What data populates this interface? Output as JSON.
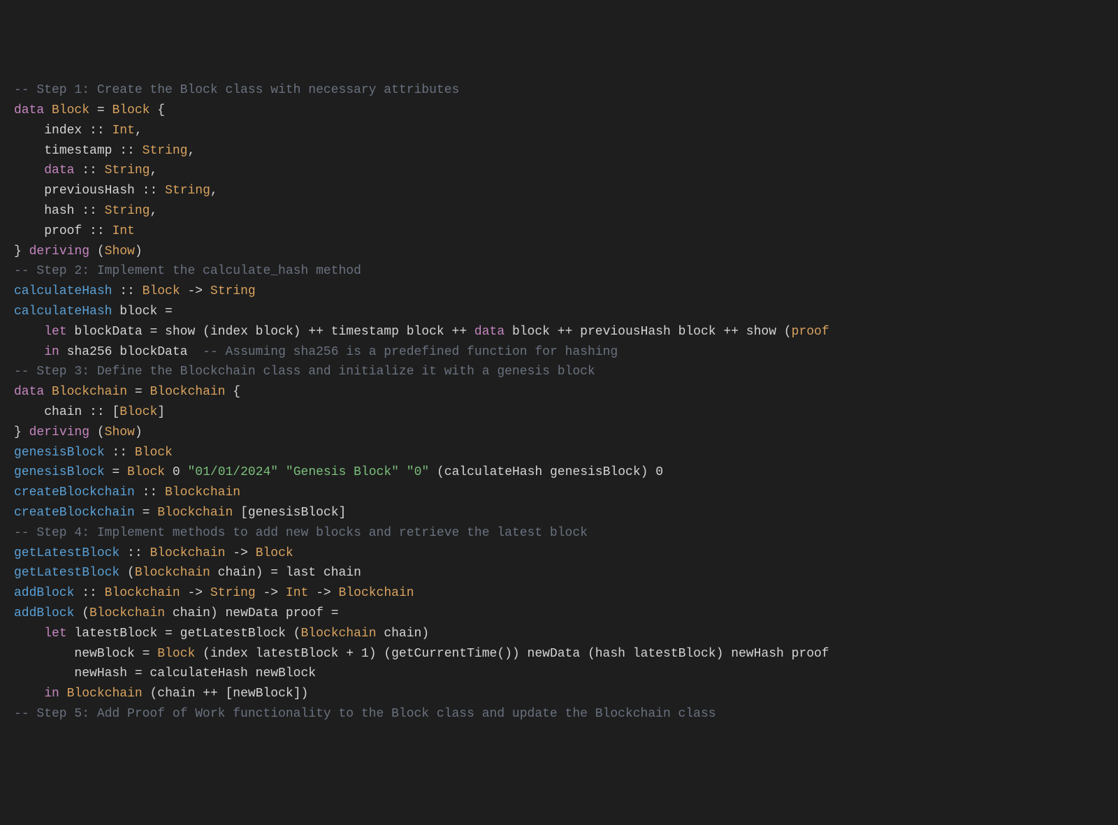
{
  "lines": [
    {
      "segments": [
        {
          "cls": "comment",
          "t": "-- Step 1: Create the Block class with necessary attributes"
        }
      ]
    },
    {
      "segments": [
        {
          "cls": "keyword",
          "t": "data"
        },
        {
          "cls": "op",
          "t": " "
        },
        {
          "cls": "type",
          "t": "Block"
        },
        {
          "cls": "op",
          "t": " = "
        },
        {
          "cls": "type",
          "t": "Block"
        },
        {
          "cls": "op",
          "t": " {"
        }
      ]
    },
    {
      "segments": [
        {
          "cls": "op",
          "t": "    "
        },
        {
          "cls": "field",
          "t": "index"
        },
        {
          "cls": "op",
          "t": " :: "
        },
        {
          "cls": "type",
          "t": "Int"
        },
        {
          "cls": "op",
          "t": ","
        }
      ]
    },
    {
      "segments": [
        {
          "cls": "op",
          "t": "    "
        },
        {
          "cls": "field",
          "t": "timestamp"
        },
        {
          "cls": "op",
          "t": " :: "
        },
        {
          "cls": "type",
          "t": "String"
        },
        {
          "cls": "op",
          "t": ","
        }
      ]
    },
    {
      "segments": [
        {
          "cls": "op",
          "t": "    "
        },
        {
          "cls": "keyword",
          "t": "data"
        },
        {
          "cls": "op",
          "t": " :: "
        },
        {
          "cls": "type",
          "t": "String"
        },
        {
          "cls": "op",
          "t": ","
        }
      ]
    },
    {
      "segments": [
        {
          "cls": "op",
          "t": "    "
        },
        {
          "cls": "field",
          "t": "previousHash"
        },
        {
          "cls": "op",
          "t": " :: "
        },
        {
          "cls": "type",
          "t": "String"
        },
        {
          "cls": "op",
          "t": ","
        }
      ]
    },
    {
      "segments": [
        {
          "cls": "op",
          "t": "    "
        },
        {
          "cls": "field",
          "t": "hash"
        },
        {
          "cls": "op",
          "t": " :: "
        },
        {
          "cls": "type",
          "t": "String"
        },
        {
          "cls": "op",
          "t": ","
        }
      ]
    },
    {
      "segments": [
        {
          "cls": "op",
          "t": "    "
        },
        {
          "cls": "field",
          "t": "proof"
        },
        {
          "cls": "op",
          "t": " :: "
        },
        {
          "cls": "type",
          "t": "Int"
        }
      ]
    },
    {
      "segments": [
        {
          "cls": "op",
          "t": "} "
        },
        {
          "cls": "deriving",
          "t": "deriving"
        },
        {
          "cls": "op",
          "t": " ("
        },
        {
          "cls": "show",
          "t": "Show"
        },
        {
          "cls": "op",
          "t": ")"
        }
      ]
    },
    {
      "segments": [
        {
          "cls": "op",
          "t": ""
        }
      ]
    },
    {
      "segments": [
        {
          "cls": "comment",
          "t": "-- Step 2: Implement the calculate_hash method"
        }
      ]
    },
    {
      "segments": [
        {
          "cls": "fn",
          "t": "calculateHash"
        },
        {
          "cls": "op",
          "t": " :: "
        },
        {
          "cls": "type",
          "t": "Block"
        },
        {
          "cls": "op",
          "t": " -> "
        },
        {
          "cls": "type",
          "t": "String"
        }
      ]
    },
    {
      "segments": [
        {
          "cls": "fn",
          "t": "calculateHash"
        },
        {
          "cls": "op",
          "t": " block ="
        }
      ]
    },
    {
      "segments": [
        {
          "cls": "op",
          "t": "    "
        },
        {
          "cls": "keyword",
          "t": "let"
        },
        {
          "cls": "op",
          "t": " blockData = show (index block) ++ timestamp block ++ "
        },
        {
          "cls": "keyword",
          "t": "data"
        },
        {
          "cls": "op",
          "t": " block ++ previousHash block ++ show ("
        },
        {
          "cls": "type",
          "t": "proof"
        }
      ]
    },
    {
      "segments": [
        {
          "cls": "op",
          "t": "    "
        },
        {
          "cls": "keyword",
          "t": "in"
        },
        {
          "cls": "op",
          "t": " sha256 blockData  "
        },
        {
          "cls": "comment",
          "t": "-- Assuming sha256 is a predefined function for hashing"
        }
      ]
    },
    {
      "segments": [
        {
          "cls": "op",
          "t": ""
        }
      ]
    },
    {
      "segments": [
        {
          "cls": "comment",
          "t": "-- Step 3: Define the Blockchain class and initialize it with a genesis block"
        }
      ]
    },
    {
      "segments": [
        {
          "cls": "keyword",
          "t": "data"
        },
        {
          "cls": "op",
          "t": " "
        },
        {
          "cls": "type",
          "t": "Blockchain"
        },
        {
          "cls": "op",
          "t": " = "
        },
        {
          "cls": "type",
          "t": "Blockchain"
        },
        {
          "cls": "op",
          "t": " {"
        }
      ]
    },
    {
      "segments": [
        {
          "cls": "op",
          "t": "    "
        },
        {
          "cls": "field",
          "t": "chain"
        },
        {
          "cls": "op",
          "t": " :: ["
        },
        {
          "cls": "type",
          "t": "Block"
        },
        {
          "cls": "op",
          "t": "]"
        }
      ]
    },
    {
      "segments": [
        {
          "cls": "op",
          "t": "} "
        },
        {
          "cls": "deriving",
          "t": "deriving"
        },
        {
          "cls": "op",
          "t": " ("
        },
        {
          "cls": "show",
          "t": "Show"
        },
        {
          "cls": "op",
          "t": ")"
        }
      ]
    },
    {
      "segments": [
        {
          "cls": "op",
          "t": ""
        }
      ]
    },
    {
      "segments": [
        {
          "cls": "fn",
          "t": "genesisBlock"
        },
        {
          "cls": "op",
          "t": " :: "
        },
        {
          "cls": "type",
          "t": "Block"
        }
      ]
    },
    {
      "segments": [
        {
          "cls": "fn",
          "t": "genesisBlock"
        },
        {
          "cls": "op",
          "t": " = "
        },
        {
          "cls": "type",
          "t": "Block"
        },
        {
          "cls": "op",
          "t": " "
        },
        {
          "cls": "num",
          "t": "0"
        },
        {
          "cls": "op",
          "t": " "
        },
        {
          "cls": "str",
          "t": "\"01/01/2024\""
        },
        {
          "cls": "op",
          "t": " "
        },
        {
          "cls": "str",
          "t": "\"Genesis Block\""
        },
        {
          "cls": "op",
          "t": " "
        },
        {
          "cls": "str",
          "t": "\"0\""
        },
        {
          "cls": "op",
          "t": " (calculateHash genesisBlock) "
        },
        {
          "cls": "num",
          "t": "0"
        }
      ]
    },
    {
      "segments": [
        {
          "cls": "op",
          "t": ""
        }
      ]
    },
    {
      "segments": [
        {
          "cls": "fn",
          "t": "createBlockchain"
        },
        {
          "cls": "op",
          "t": " :: "
        },
        {
          "cls": "type",
          "t": "Blockchain"
        }
      ]
    },
    {
      "segments": [
        {
          "cls": "fn",
          "t": "createBlockchain"
        },
        {
          "cls": "op",
          "t": " = "
        },
        {
          "cls": "type",
          "t": "Blockchain"
        },
        {
          "cls": "op",
          "t": " [genesisBlock]"
        }
      ]
    },
    {
      "segments": [
        {
          "cls": "op",
          "t": ""
        }
      ]
    },
    {
      "segments": [
        {
          "cls": "comment",
          "t": "-- Step 4: Implement methods to add new blocks and retrieve the latest block"
        }
      ]
    },
    {
      "segments": [
        {
          "cls": "fn",
          "t": "getLatestBlock"
        },
        {
          "cls": "op",
          "t": " :: "
        },
        {
          "cls": "type",
          "t": "Blockchain"
        },
        {
          "cls": "op",
          "t": " -> "
        },
        {
          "cls": "type",
          "t": "Block"
        }
      ]
    },
    {
      "segments": [
        {
          "cls": "fn",
          "t": "getLatestBlock"
        },
        {
          "cls": "op",
          "t": " ("
        },
        {
          "cls": "type",
          "t": "Blockchain"
        },
        {
          "cls": "op",
          "t": " chain) = last chain"
        }
      ]
    },
    {
      "segments": [
        {
          "cls": "op",
          "t": ""
        }
      ]
    },
    {
      "segments": [
        {
          "cls": "fn",
          "t": "addBlock"
        },
        {
          "cls": "op",
          "t": " :: "
        },
        {
          "cls": "type",
          "t": "Blockchain"
        },
        {
          "cls": "op",
          "t": " -> "
        },
        {
          "cls": "type",
          "t": "String"
        },
        {
          "cls": "op",
          "t": " -> "
        },
        {
          "cls": "type",
          "t": "Int"
        },
        {
          "cls": "op",
          "t": " -> "
        },
        {
          "cls": "type",
          "t": "Blockchain"
        }
      ]
    },
    {
      "segments": [
        {
          "cls": "fn",
          "t": "addBlock"
        },
        {
          "cls": "op",
          "t": " ("
        },
        {
          "cls": "type",
          "t": "Blockchain"
        },
        {
          "cls": "op",
          "t": " chain) newData proof ="
        }
      ]
    },
    {
      "segments": [
        {
          "cls": "op",
          "t": "    "
        },
        {
          "cls": "keyword",
          "t": "let"
        },
        {
          "cls": "op",
          "t": " latestBlock = getLatestBlock ("
        },
        {
          "cls": "type",
          "t": "Blockchain"
        },
        {
          "cls": "op",
          "t": " chain)"
        }
      ]
    },
    {
      "segments": [
        {
          "cls": "op",
          "t": "        newBlock = "
        },
        {
          "cls": "type",
          "t": "Block"
        },
        {
          "cls": "op",
          "t": " (index latestBlock + "
        },
        {
          "cls": "num",
          "t": "1"
        },
        {
          "cls": "op",
          "t": ") (getCurrentTime()) newData (hash latestBlock) newHash proof"
        }
      ]
    },
    {
      "segments": [
        {
          "cls": "op",
          "t": "        newHash = calculateHash newBlock"
        }
      ]
    },
    {
      "segments": [
        {
          "cls": "op",
          "t": "    "
        },
        {
          "cls": "keyword",
          "t": "in"
        },
        {
          "cls": "op",
          "t": " "
        },
        {
          "cls": "type",
          "t": "Blockchain"
        },
        {
          "cls": "op",
          "t": " (chain ++ [newBlock])"
        }
      ]
    },
    {
      "segments": [
        {
          "cls": "op",
          "t": ""
        }
      ]
    },
    {
      "segments": [
        {
          "cls": "comment",
          "t": "-- Step 5: Add Proof of Work functionality to the Block class and update the Blockchain class"
        }
      ]
    }
  ]
}
